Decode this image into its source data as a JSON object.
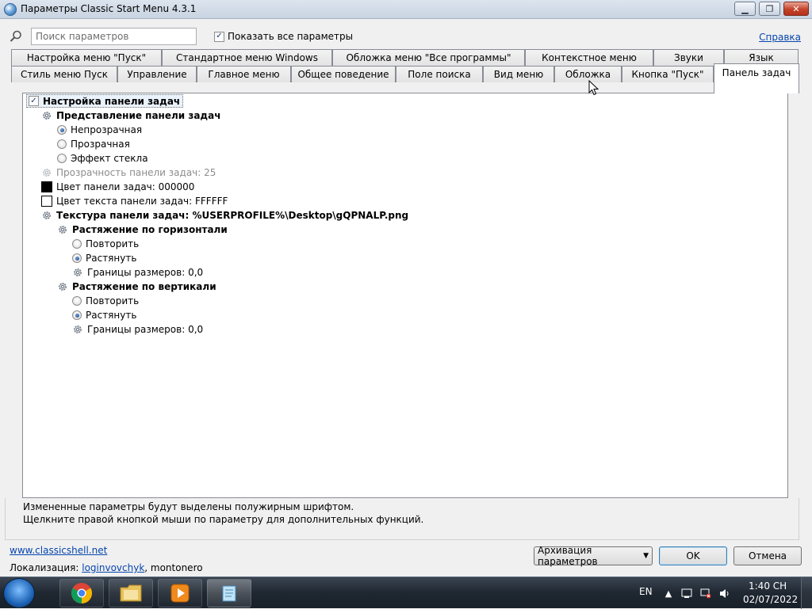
{
  "window": {
    "title": "Параметры Classic Start Menu 4.3.1",
    "minimize_glyph": "▁",
    "maximize_glyph": "❐",
    "close_glyph": "✕"
  },
  "search": {
    "placeholder": "Поиск параметров",
    "show_all_label": "Показать все параметры",
    "show_all_checked": true,
    "help_link": "Справка"
  },
  "tabs": {
    "row1": [
      "Настройка меню \"Пуск\"",
      "Стандартное меню Windows",
      "Обложка меню \"Все программы\"",
      "Контекстное меню",
      "Звуки",
      "Язык"
    ],
    "row2": [
      "Стиль меню Пуск",
      "Управление",
      "Главное меню",
      "Общее поведение",
      "Поле поиска",
      "Вид меню",
      "Обложка",
      "Кнопка \"Пуск\"",
      "Панель задач"
    ],
    "active": "Панель задач"
  },
  "tree": {
    "root": "Настройка панели задач",
    "taskbar_look": "Представление панели задач",
    "look_opaque": "Непрозрачная",
    "look_transparent": "Прозрачная",
    "look_glass": "Эффект стекла",
    "opacity": "Прозрачность панели задач: 25",
    "taskbar_color": "Цвет панели задач: 000000",
    "text_color": "Цвет текста панели задач: FFFFFF",
    "texture": "Текстура панели задач: %USERPROFILE%\\Desktop\\gQPNALP.png",
    "h_stretch": "Растяжение по горизонтали",
    "h_repeat": "Повторить",
    "h_stretch_opt": "Растянуть",
    "h_margins": "Границы размеров: 0,0",
    "v_stretch": "Растяжение по вертикали",
    "v_repeat": "Повторить",
    "v_stretch_opt": "Растянуть",
    "v_margins": "Границы размеров: 0,0"
  },
  "colors": {
    "taskbar_swatch": "#000000",
    "text_swatch": "#FFFFFF",
    "link": "#0645ad"
  },
  "info": {
    "line1": "Измененные параметры будут выделены полужирным шрифтом.",
    "line2": "Щелкните правой кнопкой мыши по параметру для дополнительных функций."
  },
  "footer": {
    "website": "www.classicshell.net",
    "localization_label": "Локализация:",
    "localizer": "loginvovchyk",
    "localizer2": ", montonero",
    "backup_button": "Архивация параметров",
    "ok_button": "OK",
    "cancel_button": "Отмена"
  },
  "taskbar": {
    "language": "EN",
    "time": "1:40 CH",
    "date": "02/07/2022",
    "icons": [
      "start-orb-icon",
      "chrome-icon",
      "explorer-folder-icon",
      "media-player-icon",
      "notepad-icon"
    ]
  }
}
